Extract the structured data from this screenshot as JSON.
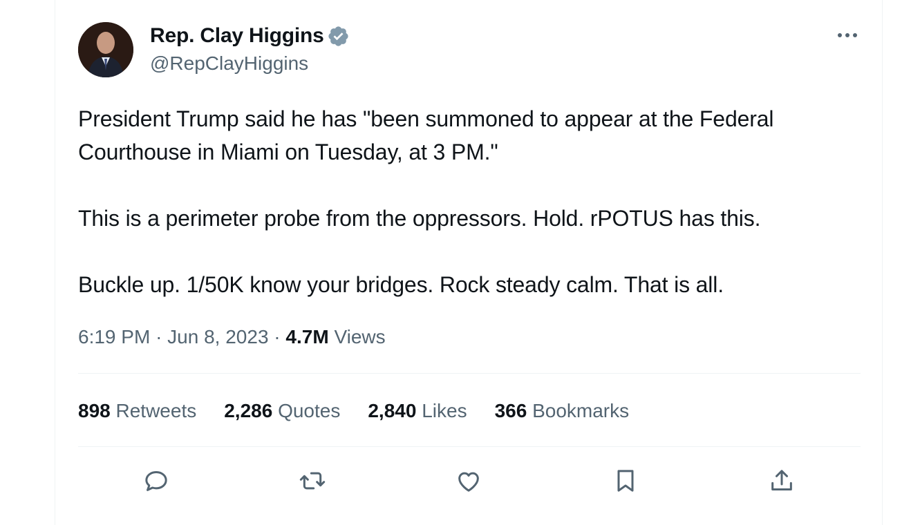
{
  "author": {
    "display_name": "Rep. Clay Higgins",
    "handle": "@RepClayHiggins",
    "avatar_icon": "profile-photo",
    "verified_icon": "verified-badge-icon",
    "verified_color": "#829aab"
  },
  "tweet": {
    "paragraphs": [
      "President Trump said he has \"been summoned to appear at the Federal Courthouse in Miami on Tuesday, at 3 PM.\"",
      "This is a perimeter probe from the oppressors. Hold. rPOTUS has this.",
      "Buckle up. 1/50K know your bridges. Rock steady calm. That is all."
    ]
  },
  "meta": {
    "time": "6:19 PM",
    "separator": "·",
    "date": "Jun 8, 2023",
    "views_count": "4.7M",
    "views_label": "Views"
  },
  "stats": [
    {
      "count": "898",
      "label": "Retweets"
    },
    {
      "count": "2,286",
      "label": "Quotes"
    },
    {
      "count": "2,840",
      "label": "Likes"
    },
    {
      "count": "366",
      "label": "Bookmarks"
    }
  ],
  "actions": {
    "reply_icon": "reply-icon",
    "retweet_icon": "retweet-icon",
    "like_icon": "like-icon",
    "bookmark_icon": "bookmark-icon",
    "share_icon": "share-icon",
    "more_icon": "more-icon"
  },
  "colors": {
    "text_primary": "#0f1419",
    "text_secondary": "#536471",
    "divider": "#eff3f4"
  }
}
